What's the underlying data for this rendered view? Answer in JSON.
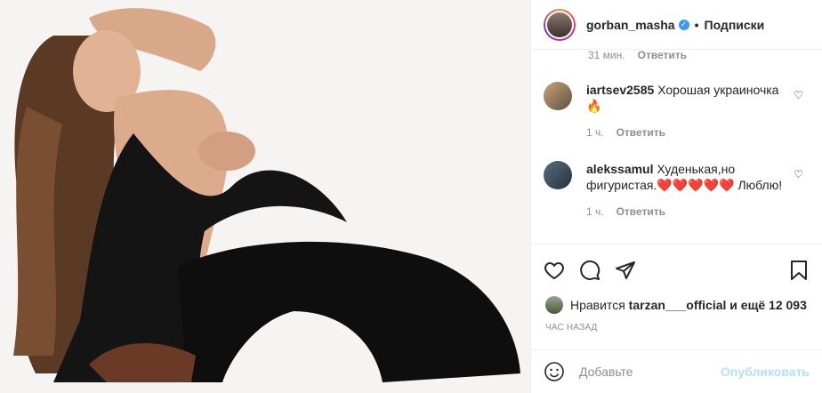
{
  "post": {
    "username": "gorban_masha",
    "follow_state": "Подписки",
    "separator": "•"
  },
  "comments": [
    {
      "meta_time": "31 мин.",
      "reply": "Ответить"
    },
    {
      "user": "iartsev2585",
      "text": "Хорошая украиночка🔥",
      "meta_time": "1 ч.",
      "reply": "Ответить"
    },
    {
      "user": "alekssamul",
      "text": "Худенькая,но фигуристая.❤️❤️❤️❤️❤️ Люблю!",
      "meta_time": "1 ч.",
      "reply": "Ответить"
    }
  ],
  "likes": {
    "prefix": "Нравится",
    "user": "tarzan___official",
    "suffix": "и ещё 12 093"
  },
  "timestamp": "ЧАС НАЗАД",
  "add_comment": {
    "placeholder": "Добавьте",
    "publish": "Опубликовать"
  },
  "icons": {
    "verified": "verified-badge-icon",
    "like": "heart-icon",
    "comment": "comment-icon",
    "share": "share-icon",
    "save": "bookmark-icon",
    "emoji": "emoji-icon"
  },
  "colors": {
    "verified": "#3897f0",
    "publish_disabled": "#b2dffc",
    "muted": "#8e8e8e"
  }
}
